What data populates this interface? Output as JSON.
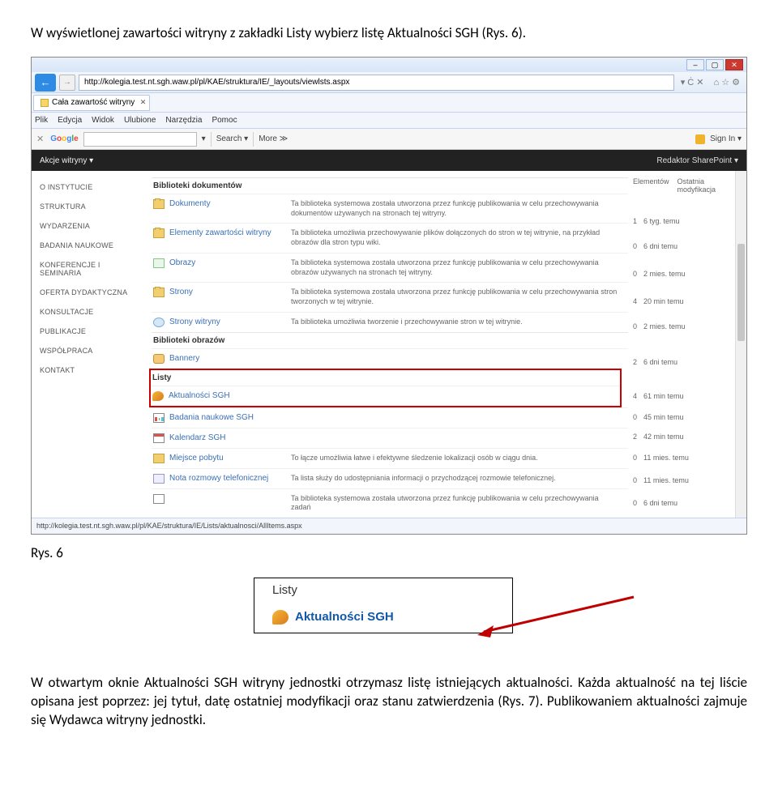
{
  "intro_text": "W wyświetlonej zawartości witryny z zakładki Listy wybierz listę Aktualności SGH (Rys. 6).",
  "caption6": "Rys. 6",
  "para2_text": "W otwartym oknie Aktualności SGH witryny jednostki otrzymasz listę istniejących aktualności. Każda aktualność na tej liście opisana jest poprzez: jej tytuł, datę ostatniej modyfikacji oraz stanu zatwierdzenia (Rys. 7). Publikowaniem aktualności zajmuje się Wydawca witryny jednostki.",
  "browser": {
    "address_url": "http://kolegia.test.nt.sgh.waw.pl/pl/KAE/struktura/IE/_layouts/viewlsts.aspx",
    "addr_right_text": "▾ Ċ ✕",
    "tab_title": "Cała zawartość witryny",
    "menu": [
      "Plik",
      "Edycja",
      "Widok",
      "Ulubione",
      "Narzędzia",
      "Pomoc"
    ],
    "google": {
      "label": "Google",
      "search": "Search ▾",
      "more": "More ≫",
      "signin": "Sign In ▾"
    },
    "status_url": "http://kolegia.test.nt.sgh.waw.pl/pl/KAE/struktura/IE/Lists/aktualnosci/AllItems.aspx"
  },
  "sp": {
    "ribbon_label": "Akcje witryny ▾",
    "user_label": "Redaktor SharePoint ▾",
    "nav": [
      "O INSTYTUCIE",
      "STRUKTURA",
      "WYDARZENIA",
      "BADANIA NAUKOWE",
      "KONFERENCJE I SEMINARIA",
      "OFERTA DYDAKTYCZNA",
      "KONSULTACJE",
      "PUBLIKACJE",
      "WSPÓŁPRACA",
      "KONTAKT"
    ],
    "meta_head_1": "Elementów",
    "meta_head_2": "Ostatnia modyfikacja",
    "sections": [
      {
        "title": "Biblioteki dokumentów",
        "items": [
          {
            "icon": "ic-folder",
            "name": "Dokumenty",
            "desc": "Ta biblioteka systemowa została utworzona przez funkcję publikowania w celu przechowywania dokumentów używanych na stronach tej witryny.",
            "count": "1",
            "mod": "6 tyg. temu"
          },
          {
            "icon": "ic-folder",
            "name": "Elementy zawartości witryny",
            "desc": "Ta biblioteka umożliwia przechowywanie plików dołączonych do stron w tej witrynie, na przykład obrazów dla stron typu wiki.",
            "count": "0",
            "mod": "6 dni temu"
          },
          {
            "icon": "ic-img",
            "name": "Obrazy",
            "desc": "Ta biblioteka systemowa została utworzona przez funkcję publikowania w celu przechowywania obrazów używanych na stronach tej witryny.",
            "count": "0",
            "mod": "2 mies. temu"
          },
          {
            "icon": "ic-folder",
            "name": "Strony",
            "desc": "Ta biblioteka systemowa została utworzona przez funkcję publikowania w celu przechowywania stron tworzonych w tej witrynie.",
            "count": "4",
            "mod": "20 min temu"
          },
          {
            "icon": "ic-globe",
            "name": "Strony witryny",
            "desc": "Ta biblioteka umożliwia tworzenie i przechowywanie stron w tej witrynie.",
            "count": "0",
            "mod": "2 mies. temu"
          }
        ]
      },
      {
        "title": "Biblioteki obrazów",
        "items": [
          {
            "icon": "ic-promo",
            "name": "Bannery",
            "desc": "",
            "count": "2",
            "mod": "6 dni temu"
          }
        ]
      }
    ],
    "listy_title": "Listy",
    "listy_first": {
      "icon": "ic-announce",
      "name": "Aktualności SGH",
      "count": "4",
      "mod": "61 min temu"
    },
    "listy_rest": [
      {
        "icon": "ic-chart",
        "name": "Badania naukowe SGH",
        "desc": "",
        "count": "0",
        "mod": "45 min temu"
      },
      {
        "icon": "ic-cal",
        "name": "Kalendarz SGH",
        "desc": "",
        "count": "2",
        "mod": "42 min temu"
      },
      {
        "icon": "ic-loc",
        "name": "Miejsce pobytu",
        "desc": "To łącze umożliwia łatwe i efektywne śledzenie lokalizacji osób w ciągu dnia.",
        "count": "0",
        "mod": "11 mies. temu"
      },
      {
        "icon": "ic-phone",
        "name": "Nota rozmowy telefonicznej",
        "desc": "Ta lista służy do udostępniania informacji o przychodzącej rozmowie telefonicznej.",
        "count": "0",
        "mod": "11 mies. temu"
      },
      {
        "icon": "ic-page",
        "name": "",
        "desc": "Ta biblioteka systemowa została utworzona przez funkcję publikowania w celu przechowywania zadań",
        "count": "0",
        "mod": "6 dni temu"
      }
    ]
  },
  "zoom": {
    "listy": "Listy",
    "akt": "Aktualności SGH"
  }
}
